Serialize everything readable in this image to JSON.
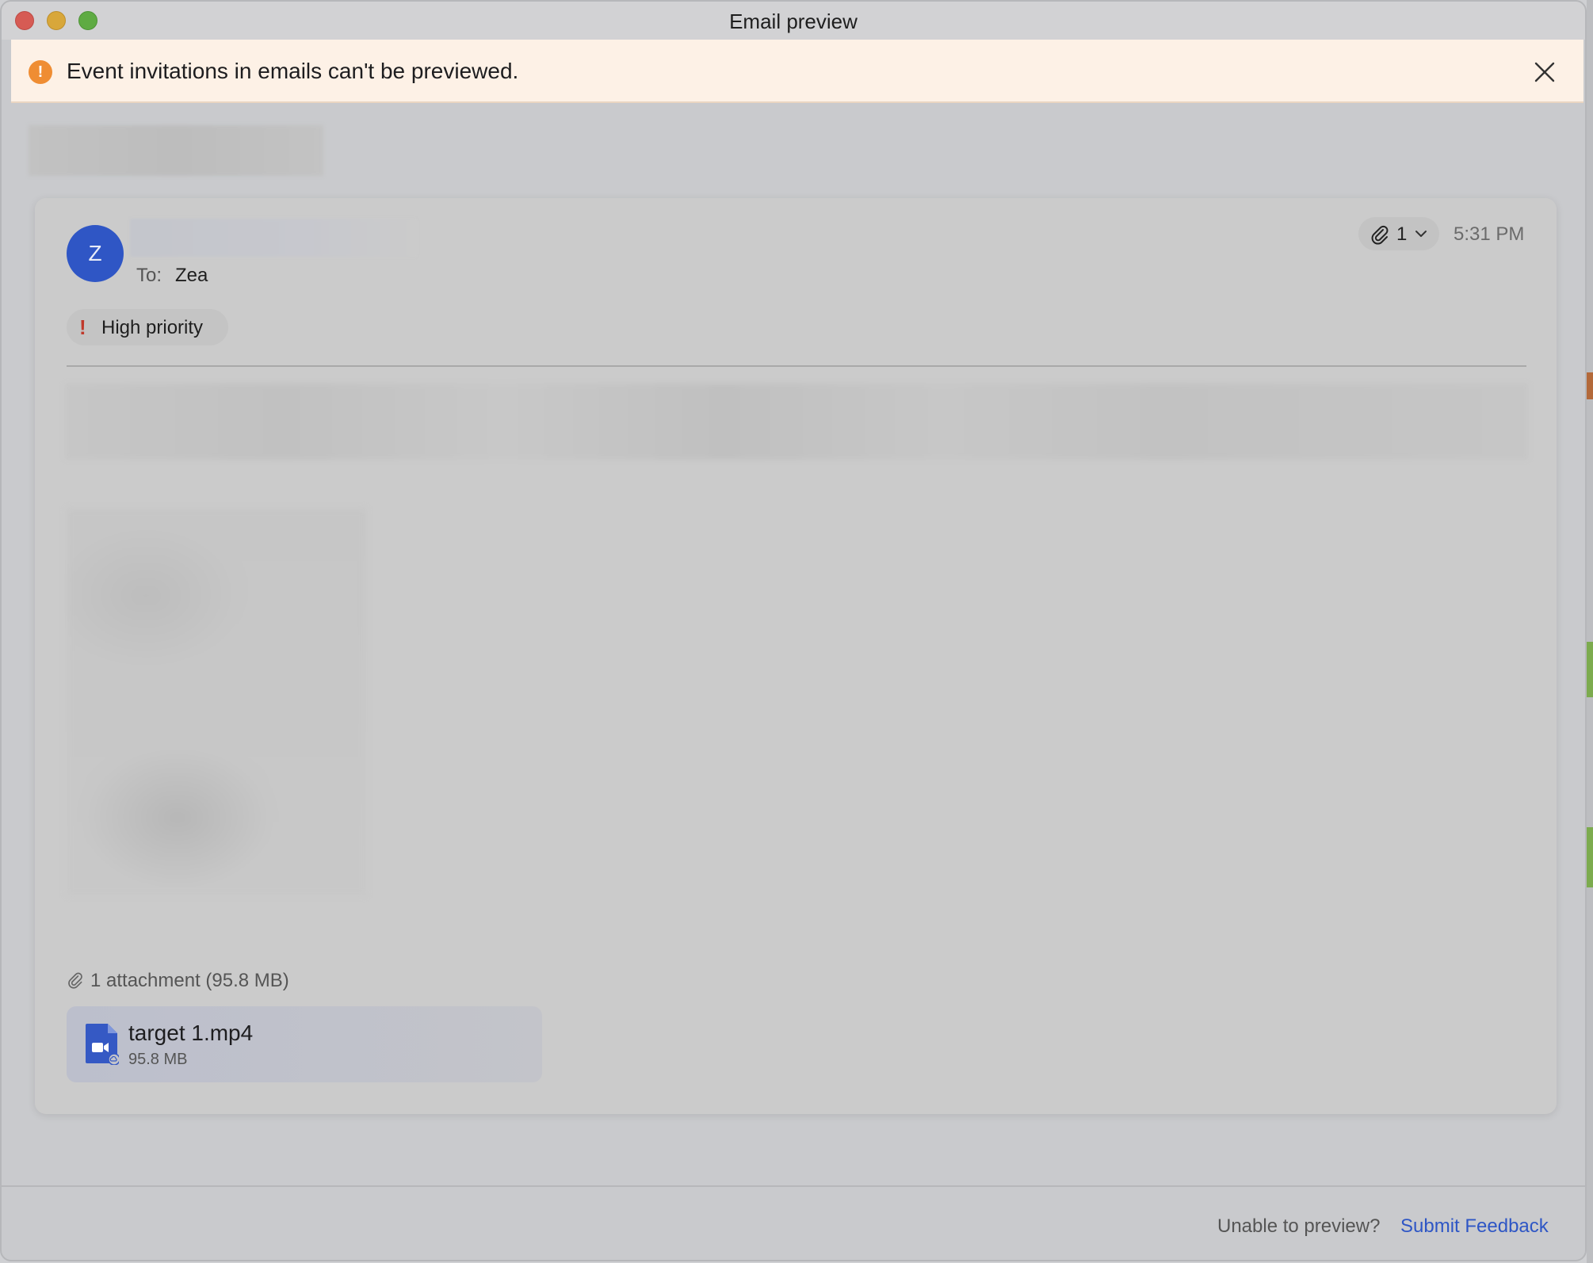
{
  "window": {
    "title": "Email preview"
  },
  "banner": {
    "message": "Event invitations in emails can't be previewed.",
    "icon": "warning-icon",
    "color": "#ef8d33"
  },
  "email": {
    "avatar_letter": "Z",
    "avatar_color": "#2f56c5",
    "to_label": "To:",
    "to_name": "Zea",
    "attachment_count": "1",
    "time": "5:31 PM",
    "priority_label": "High priority",
    "priority_mark": "!",
    "attachment_summary": "1 attachment (95.8 MB)",
    "attachment": {
      "name": "target 1.mp4",
      "size": "95.8 MB",
      "icon": "video-file-icon"
    }
  },
  "footer": {
    "question": "Unable to preview?",
    "link": "Submit Feedback",
    "link_color": "#2e56c5"
  }
}
